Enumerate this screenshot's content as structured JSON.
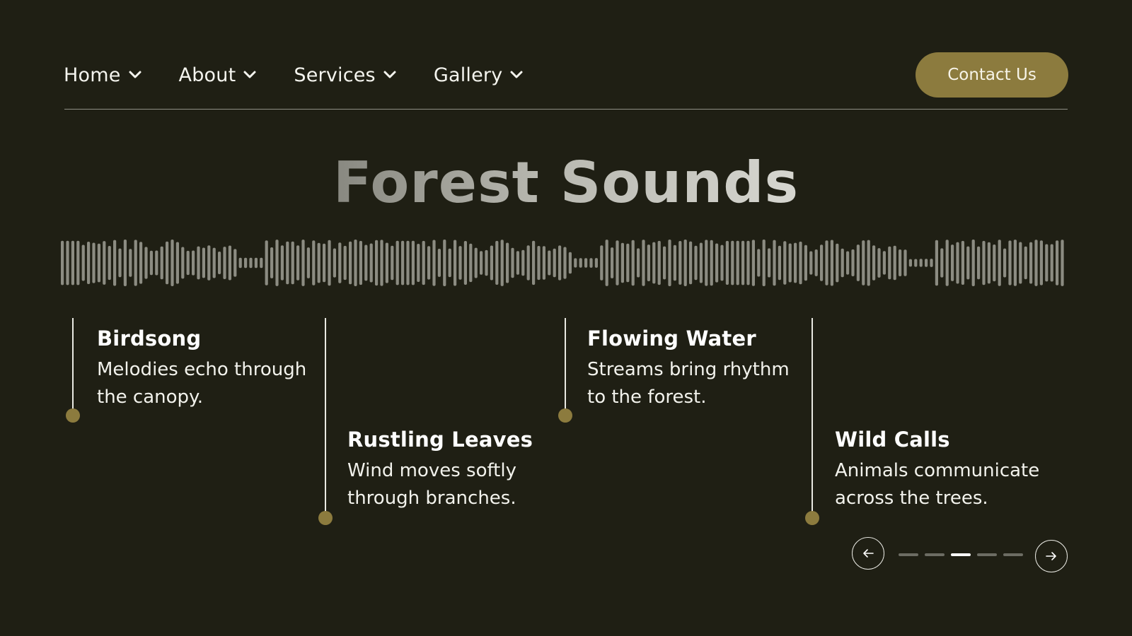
{
  "nav": {
    "items": [
      {
        "label": "Home"
      },
      {
        "label": "About"
      },
      {
        "label": "Services"
      },
      {
        "label": "Gallery"
      }
    ],
    "contact_label": "Contact Us"
  },
  "hero": {
    "title": "Forest Sounds"
  },
  "timeline": [
    {
      "title": "Birdsong",
      "desc_line1": "Melodies echo through",
      "desc_line2": "the canopy."
    },
    {
      "title": "Rustling Leaves",
      "desc_line1": "Wind moves softly",
      "desc_line2": "through branches."
    },
    {
      "title": "Flowing Water",
      "desc_line1": "Streams bring rhythm",
      "desc_line2": "to the forest."
    },
    {
      "title": "Wild Calls",
      "desc_line1": "Animals communicate",
      "desc_line2": "across the trees."
    }
  ],
  "pagination": {
    "total": 5,
    "active_index": 2
  },
  "colors": {
    "background": "#1f1f14",
    "accent": "#8c7b3e",
    "waveform": "#8c8c82"
  },
  "icons": {
    "nav_chevron": "chevron-down-icon",
    "prev": "arrow-left-icon",
    "next": "arrow-right-icon"
  }
}
